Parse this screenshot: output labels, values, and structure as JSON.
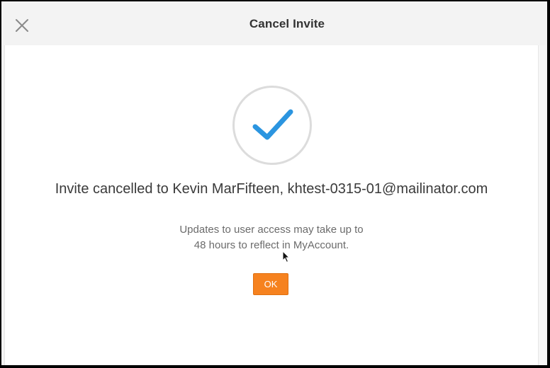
{
  "dialog": {
    "title": "Cancel Invite",
    "close_icon": "close-icon"
  },
  "confirmation": {
    "icon": "checkmark-icon",
    "accent_color": "#2b95e0",
    "headline": "Invite cancelled to Kevin MarFifteen, khtest-0315-01@mailinator.com",
    "note_line_1": "Updates to user access may take up to",
    "note_line_2": "48 hours to reflect in MyAccount.",
    "ok_label": "OK",
    "ok_color": "#f6821f"
  }
}
